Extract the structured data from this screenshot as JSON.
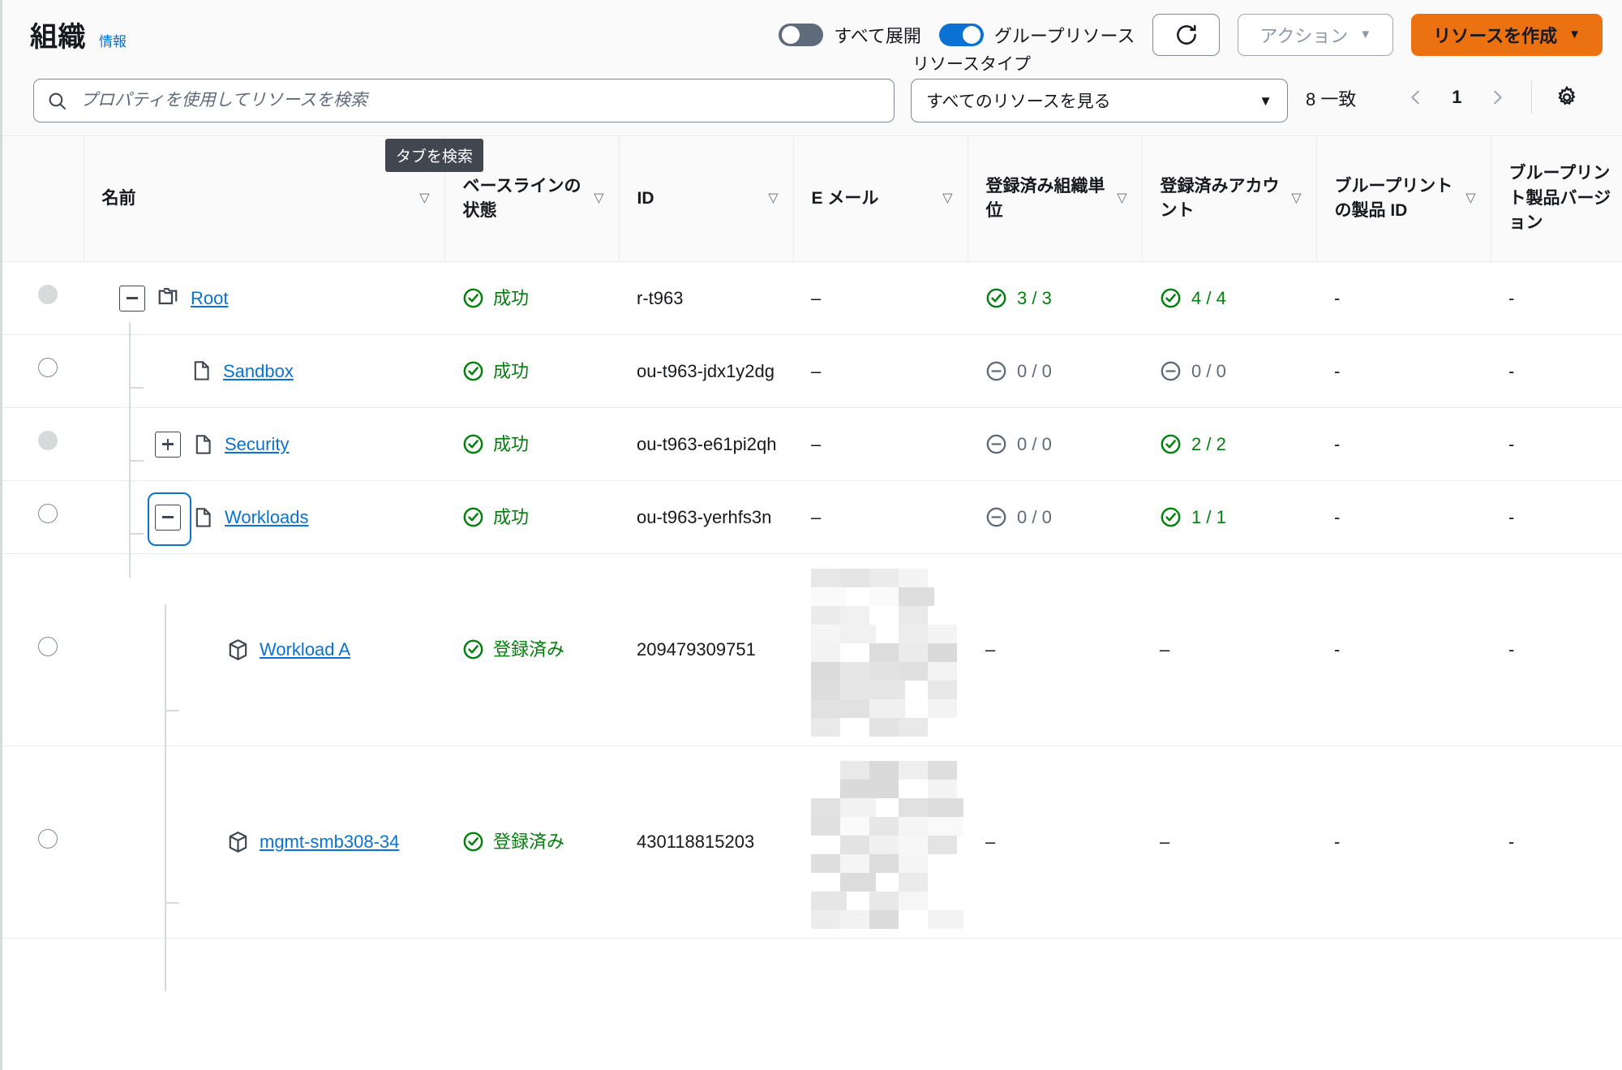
{
  "header": {
    "title": "組織",
    "info_link": "情報",
    "toggles": [
      {
        "label": "すべて展開",
        "state": "off"
      },
      {
        "label": "グループリソース",
        "state": "on"
      }
    ],
    "refresh_icon": "refresh-icon",
    "actions_button": "アクション",
    "create_button": "リソースを作成",
    "caret": "▼"
  },
  "filters": {
    "search_placeholder": "プロパティを使用してリソースを検索",
    "search_value": "",
    "search_icon": "search-icon",
    "resource_type_label": "リソースタイプ",
    "resource_type_value": "すべてのリソースを見る",
    "resource_type_caret": "▼",
    "match_count": "8 一致",
    "pagination": {
      "prev": "‹",
      "page": "1",
      "next": "›"
    },
    "settings_icon": "gear-icon",
    "tooltip": "タブを検索"
  },
  "table": {
    "columns": [
      {
        "label": "名前",
        "sortable": true
      },
      {
        "label": "ベースラインの状態",
        "sortable": true
      },
      {
        "label": "ID",
        "sortable": true
      },
      {
        "label": "E メール",
        "sortable": true
      },
      {
        "label": "登録済み組織単位",
        "sortable": true
      },
      {
        "label": "登録済みアカウント",
        "sortable": true
      },
      {
        "label": "ブループリントの製品 ID",
        "sortable": true
      },
      {
        "label": "ブループリント製品バージョン",
        "sortable": false
      }
    ],
    "sort_icon": "▽",
    "rows": [
      {
        "name": "Root",
        "type": "root",
        "depth": 0,
        "expander": "collapse",
        "node_icon": "folders-icon",
        "selected": false,
        "radio_disabled": true,
        "baseline_status": "成功",
        "baseline_state": "ok",
        "id": "r-t963",
        "email": "–",
        "email_redacted": false,
        "registered_ou": "3 / 3",
        "registered_ou_state": "ok",
        "registered_accounts": "4 / 4",
        "registered_accounts_state": "ok",
        "blueprint_product_id": "-",
        "blueprint_product_version": "-"
      },
      {
        "name": "Sandbox",
        "type": "ou",
        "depth": 1,
        "expander": "none",
        "node_icon": "folder-icon",
        "selected": false,
        "radio_disabled": false,
        "baseline_status": "成功",
        "baseline_state": "ok",
        "id": "ou-t963-jdx1y2dg",
        "email": "–",
        "email_redacted": false,
        "registered_ou": "0 / 0",
        "registered_ou_state": "neutral",
        "registered_accounts": "0 / 0",
        "registered_accounts_state": "neutral",
        "blueprint_product_id": "-",
        "blueprint_product_version": "-"
      },
      {
        "name": "Security",
        "type": "ou",
        "depth": 1,
        "expander": "expand",
        "node_icon": "folder-icon",
        "selected": false,
        "radio_disabled": true,
        "baseline_status": "成功",
        "baseline_state": "ok",
        "id": "ou-t963-e61pi2qh",
        "email": "–",
        "email_redacted": false,
        "registered_ou": "0 / 0",
        "registered_ou_state": "neutral",
        "registered_accounts": "2 / 2",
        "registered_accounts_state": "ok",
        "blueprint_product_id": "-",
        "blueprint_product_version": "-"
      },
      {
        "name": "Workloads",
        "type": "ou",
        "depth": 1,
        "expander": "collapse",
        "expander_focused": true,
        "node_icon": "folder-icon",
        "selected": false,
        "radio_disabled": false,
        "baseline_status": "成功",
        "baseline_state": "ok",
        "id": "ou-t963-yerhfs3n",
        "email": "–",
        "email_redacted": false,
        "registered_ou": "0 / 0",
        "registered_ou_state": "neutral",
        "registered_accounts": "1 / 1",
        "registered_accounts_state": "ok",
        "blueprint_product_id": "-",
        "blueprint_product_version": "-"
      },
      {
        "name": "Workload A",
        "type": "account",
        "depth": 2,
        "expander": "none",
        "node_icon": "cube-icon",
        "selected": false,
        "radio_disabled": false,
        "baseline_status": "登録済み",
        "baseline_state": "ok",
        "id": "209479309751",
        "email": "",
        "email_redacted": true,
        "registered_ou": "–",
        "registered_ou_state": "plain",
        "registered_accounts": "–",
        "registered_accounts_state": "plain",
        "blueprint_product_id": "-",
        "blueprint_product_version": "-"
      },
      {
        "name": "mgmt-smb308-34",
        "type": "account",
        "depth": 2,
        "expander": "none",
        "node_icon": "cube-icon",
        "selected": false,
        "radio_disabled": false,
        "baseline_status": "登録済み",
        "baseline_state": "ok",
        "id": "430118815203",
        "email": "",
        "email_redacted": true,
        "registered_ou": "–",
        "registered_ou_state": "plain",
        "registered_accounts": "–",
        "registered_accounts_state": "plain",
        "blueprint_product_id": "-",
        "blueprint_product_version": "-"
      }
    ]
  },
  "colors": {
    "accent": "#0972d3",
    "primary_button": "#ec7211",
    "success": "#037f0c",
    "neutral": "#5f6b7a",
    "header_bg": "#fafafa",
    "border": "#e9ebed"
  }
}
